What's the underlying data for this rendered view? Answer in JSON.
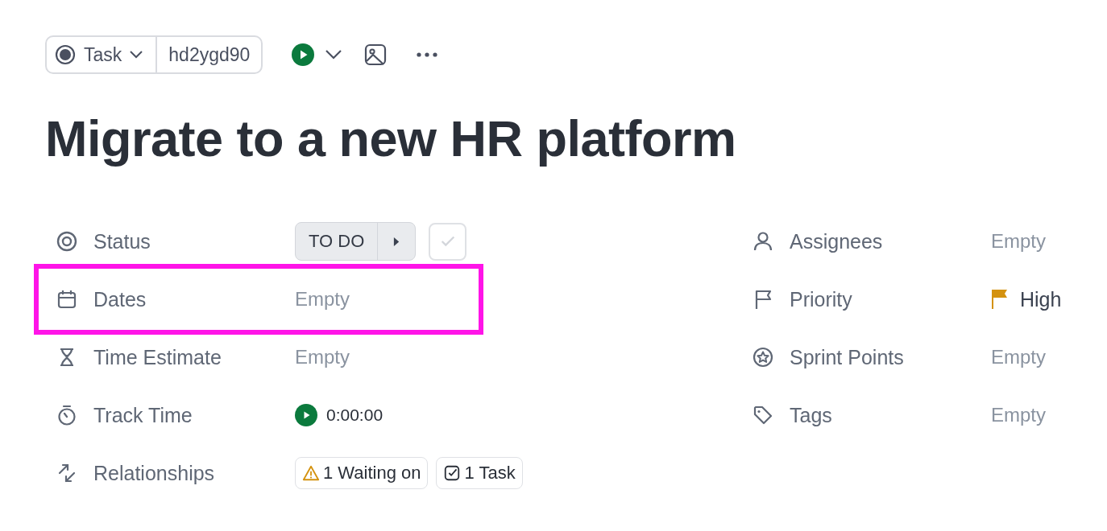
{
  "header": {
    "type_label": "Task",
    "task_id": "hd2ygd90"
  },
  "title": "Migrate to a new HR platform",
  "left_fields": [
    {
      "kind": "status",
      "label": "Status",
      "value": "TO DO",
      "highlighted": false
    },
    {
      "kind": "empty",
      "label": "Dates",
      "value": "Empty",
      "highlighted": true
    },
    {
      "kind": "empty",
      "label": "Time Estimate",
      "value": "Empty",
      "highlighted": false
    },
    {
      "kind": "timer",
      "label": "Track Time",
      "value": "0:00:00",
      "highlighted": false
    },
    {
      "kind": "chips",
      "label": "Relationships",
      "chips": [
        {
          "kind": "waiting",
          "label": "1 Waiting on"
        },
        {
          "kind": "task",
          "label": "1 Task"
        }
      ],
      "highlighted": false
    }
  ],
  "right_fields": [
    {
      "kind": "empty",
      "label": "Assignees",
      "value": "Empty"
    },
    {
      "kind": "flag",
      "label": "Priority",
      "value": "High",
      "color": "#d4920f"
    },
    {
      "kind": "empty",
      "label": "Sprint Points",
      "value": "Empty"
    },
    {
      "kind": "empty",
      "label": "Tags",
      "value": "Empty"
    }
  ]
}
